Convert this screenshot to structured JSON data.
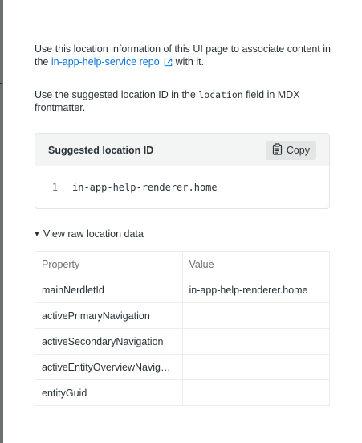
{
  "intro": {
    "prefix": "Use this location information of this UI page to associate content in the ",
    "link_label": "in-app-help-service repo",
    "suffix": "with it.",
    "link_icon": "external-link-icon"
  },
  "instruction": {
    "prefix": "Use the suggested location ID in the ",
    "code": "location",
    "suffix": " field in MDX frontmatter."
  },
  "location_card": {
    "title": "Suggested location ID",
    "copy_label": "Copy",
    "copy_icon": "clipboard-icon",
    "line_number": "1",
    "location_id": "in-app-help-renderer.home"
  },
  "raw_data": {
    "toggle_label": "View raw location data",
    "toggle_icon": "caret-down-icon",
    "columns": [
      "Property",
      "Value"
    ],
    "rows": [
      {
        "property": "mainNerdletId",
        "value": "in-app-help-renderer.home"
      },
      {
        "property": "activePrimaryNavigation",
        "value": ""
      },
      {
        "property": "activeSecondaryNavigation",
        "value": ""
      },
      {
        "property": "activeEntityOverviewNavigation",
        "value": ""
      },
      {
        "property": "entityGuid",
        "value": ""
      }
    ]
  },
  "colors": {
    "text": "#293338",
    "link": "#0c74df",
    "muted": "#6b6f72",
    "card_header_bg": "#f3f4f4",
    "button_bg": "#e3e4e4",
    "border": "#e3e4e4"
  }
}
